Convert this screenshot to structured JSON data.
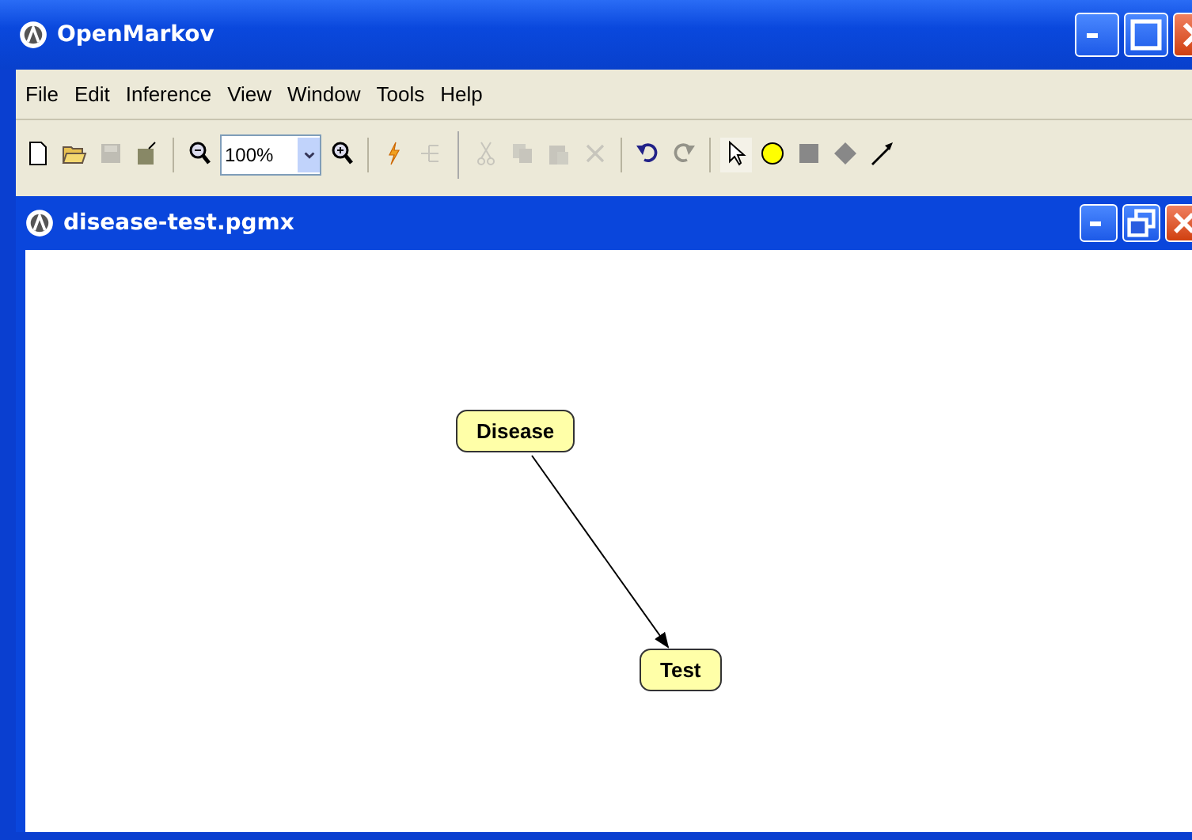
{
  "window": {
    "title": "OpenMarkov"
  },
  "menu": [
    "File",
    "Edit",
    "Inference",
    "View",
    "Window",
    "Tools",
    "Help"
  ],
  "toolbar": [
    {
      "kind": "new",
      "disabled": false
    },
    {
      "kind": "open",
      "disabled": false
    },
    {
      "kind": "save",
      "disabled": true
    },
    {
      "kind": "save-as",
      "disabled": false
    },
    {
      "kind": "sep"
    },
    {
      "kind": "zoom-out",
      "disabled": false
    },
    {
      "kind": "zoom",
      "value": "100%"
    },
    {
      "kind": "zoom-in",
      "disabled": false
    },
    {
      "kind": "sep"
    },
    {
      "kind": "inference",
      "disabled": false
    },
    {
      "kind": "tree",
      "disabled": true
    },
    {
      "kind": "group"
    },
    {
      "kind": "cut",
      "disabled": true
    },
    {
      "kind": "copy",
      "disabled": true
    },
    {
      "kind": "paste",
      "disabled": true
    },
    {
      "kind": "delete",
      "disabled": true
    },
    {
      "kind": "sep"
    },
    {
      "kind": "undo",
      "disabled": false
    },
    {
      "kind": "redo",
      "disabled": true
    },
    {
      "kind": "sep"
    },
    {
      "kind": "select",
      "selected": true
    },
    {
      "kind": "chance-node",
      "selected": false
    },
    {
      "kind": "decision-node",
      "selected": false
    },
    {
      "kind": "utility-node",
      "selected": false
    },
    {
      "kind": "link",
      "selected": false
    }
  ],
  "document": {
    "title": "disease-test.pgmx",
    "nodes": [
      {
        "label": "Disease"
      },
      {
        "label": "Test"
      }
    ]
  }
}
